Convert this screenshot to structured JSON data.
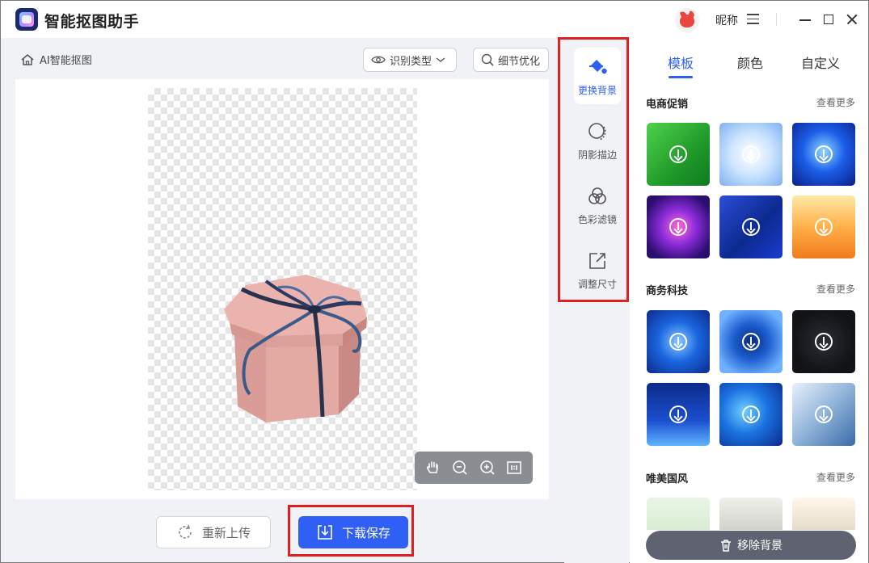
{
  "app": {
    "title": "智能抠图助手"
  },
  "header": {
    "nickname": "昵称"
  },
  "workspace": {
    "breadcrumb": "AI智能抠图",
    "recognize_type_label": "识别类型",
    "detail_optimize_label": "细节优化",
    "reupload_label": "重新上传",
    "download_label": "下载保存"
  },
  "tools": [
    {
      "label": "更换背景",
      "icon": "paint-bucket-icon",
      "active": true
    },
    {
      "label": "阴影描边",
      "icon": "shadow-circle-icon",
      "active": false
    },
    {
      "label": "色彩滤镜",
      "icon": "color-filter-icon",
      "active": false
    },
    {
      "label": "调整尺寸",
      "icon": "resize-icon",
      "active": false
    }
  ],
  "panel": {
    "tabs": [
      "模板",
      "颜色",
      "自定义"
    ],
    "active_tab": "模板",
    "sections": [
      {
        "title": "电商促销",
        "more": "查看更多"
      },
      {
        "title": "商务科技",
        "more": "查看更多"
      },
      {
        "title": "唯美国风",
        "more": "查看更多"
      }
    ],
    "remove_bg_label": "移除背景"
  },
  "colors": {
    "accent": "#2f5ff5",
    "highlight": "#e02020"
  }
}
